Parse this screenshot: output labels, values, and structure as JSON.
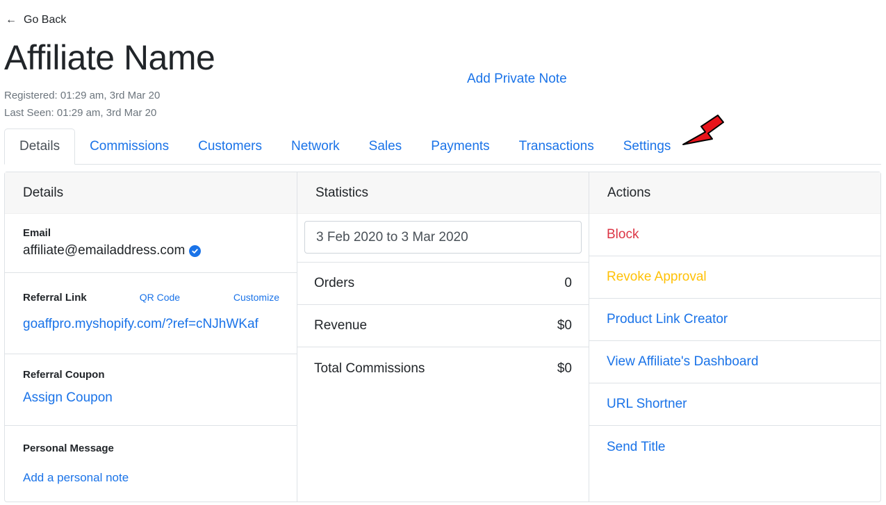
{
  "header": {
    "go_back": "Go Back",
    "go_back_icon": "arrow-left-icon",
    "title": "Affiliate Name",
    "registered": "Registered: 01:29 am, 3rd Mar 20",
    "last_seen": "Last Seen: 01:29 am, 3rd Mar 20",
    "add_private_note": "Add Private Note"
  },
  "tabs": [
    {
      "label": "Details",
      "active": true
    },
    {
      "label": "Commissions"
    },
    {
      "label": "Customers"
    },
    {
      "label": "Network"
    },
    {
      "label": "Sales"
    },
    {
      "label": "Payments"
    },
    {
      "label": "Transactions"
    },
    {
      "label": "Settings"
    }
  ],
  "annotation": {
    "icon": "red-pointer-arrow-icon",
    "color": "#e8141b"
  },
  "details": {
    "title": "Details",
    "email_label": "Email",
    "email": "affiliate@emailaddress.com",
    "verified_icon": "verified-check-icon",
    "referral_link_label": "Referral Link",
    "qr_code": "QR Code",
    "customize": "Customize",
    "referral_link": "goaffpro.myshopify.com/?ref=cNJhWKaf",
    "referral_coupon_label": "Referral Coupon",
    "assign_coupon": "Assign Coupon",
    "personal_message_label": "Personal Message",
    "add_personal_note": "Add a personal note"
  },
  "statistics": {
    "title": "Statistics",
    "date_range": "3 Feb 2020 to 3 Mar 2020",
    "rows": [
      {
        "label": "Orders",
        "value": "0"
      },
      {
        "label": "Revenue",
        "value": "$0"
      },
      {
        "label": "Total Commissions",
        "value": "$0"
      }
    ]
  },
  "actions": {
    "title": "Actions",
    "items": [
      {
        "label": "Block",
        "color": "#dc3545"
      },
      {
        "label": "Revoke Approval",
        "color": "#ffc107"
      },
      {
        "label": "Product Link Creator",
        "color": "#1a73e8"
      },
      {
        "label": "View Affiliate's Dashboard",
        "color": "#1a73e8"
      },
      {
        "label": "URL Shortner",
        "color": "#1a73e8"
      },
      {
        "label": "Send Title",
        "color": "#1a73e8"
      }
    ]
  },
  "colors": {
    "link": "#1a73e8",
    "danger": "#dc3545",
    "warning": "#ffc107",
    "muted": "#6c757d"
  }
}
